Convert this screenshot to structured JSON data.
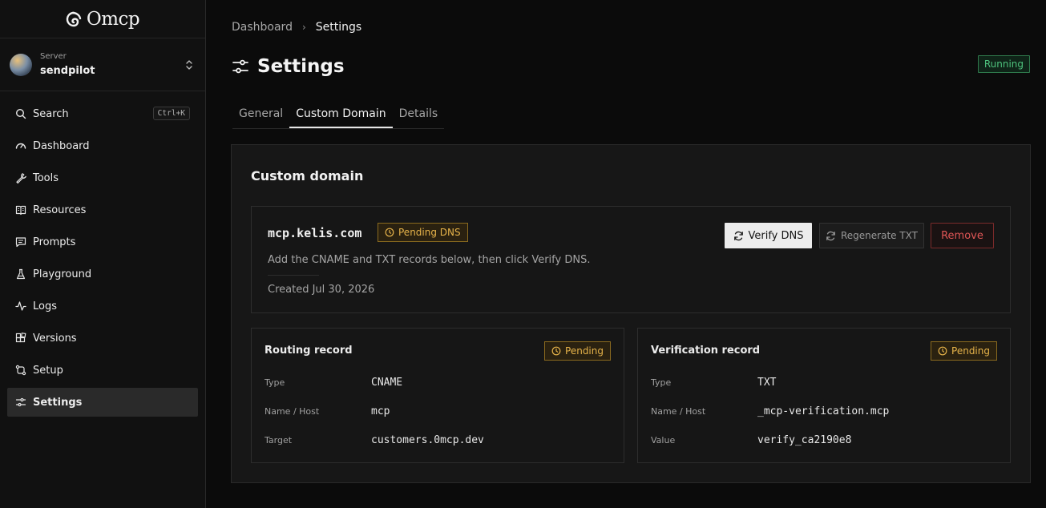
{
  "app": {
    "name": "Omcp"
  },
  "server": {
    "label": "Server",
    "name": "sendpilot"
  },
  "search": {
    "label": "Search",
    "shortcut": "Ctrl+K"
  },
  "nav": [
    {
      "label": "Dashboard",
      "icon": "gauge-icon"
    },
    {
      "label": "Tools",
      "icon": "wrench-icon"
    },
    {
      "label": "Resources",
      "icon": "book-icon"
    },
    {
      "label": "Prompts",
      "icon": "message-icon"
    },
    {
      "label": "Playground",
      "icon": "flask-icon"
    },
    {
      "label": "Logs",
      "icon": "activity-icon"
    },
    {
      "label": "Versions",
      "icon": "blocks-icon"
    },
    {
      "label": "Setup",
      "icon": "route-icon"
    },
    {
      "label": "Settings",
      "icon": "sliders-icon",
      "active": true
    }
  ],
  "breadcrumb": {
    "parent": "Dashboard",
    "separator": "›",
    "current": "Settings"
  },
  "page": {
    "title": "Settings",
    "status": "Running",
    "status_color": "#4ec27d"
  },
  "tabs": [
    {
      "label": "General"
    },
    {
      "label": "Custom Domain",
      "active": true
    },
    {
      "label": "Details"
    }
  ],
  "panel": {
    "title": "Custom domain",
    "domain": {
      "name": "mcp.kelis.com",
      "status": "Pending DNS",
      "description": "Add the CNAME and TXT records below, then click Verify DNS.",
      "created": "Created Jul 30, 2026",
      "verify_label": "Verify DNS",
      "regenerate_label": "Regenerate TXT",
      "remove_label": "Remove"
    },
    "routing": {
      "title": "Routing record",
      "status": "Pending",
      "rows": [
        {
          "key": "Type",
          "value": "CNAME"
        },
        {
          "key": "Name / Host",
          "value": "mcp"
        },
        {
          "key": "Target",
          "value": "customers.0mcp.dev"
        }
      ]
    },
    "verification": {
      "title": "Verification record",
      "status": "Pending",
      "rows": [
        {
          "key": "Type",
          "value": "TXT"
        },
        {
          "key": "Name / Host",
          "value": "_mcp-verification.mcp"
        },
        {
          "key": "Value",
          "value": "verify_ca2190e8"
        }
      ]
    }
  },
  "colors": {
    "pending": "#e6b34a",
    "danger": "#e05656",
    "accent": "#ececec"
  }
}
